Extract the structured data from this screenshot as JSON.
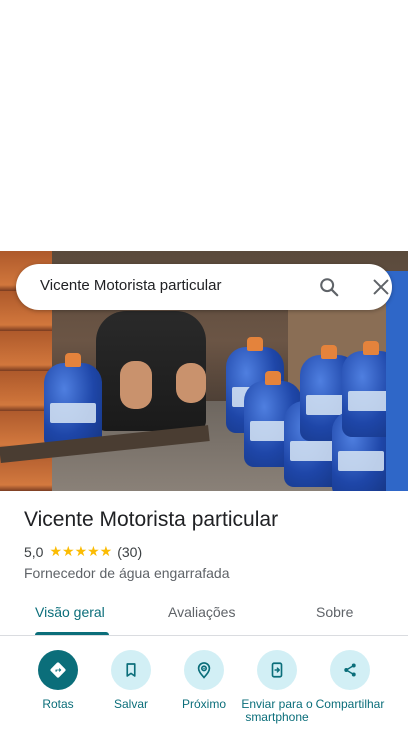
{
  "search": {
    "query": "Vicente Motorista particular"
  },
  "place": {
    "title": "Vicente Motorista particular",
    "rating": "5,0",
    "stars": "★★★★★",
    "review_count": "(30)",
    "category": "Fornecedor de água engarrafada"
  },
  "tabs": [
    {
      "label": "Visão geral",
      "active": true
    },
    {
      "label": "Avaliações",
      "active": false
    },
    {
      "label": "Sobre",
      "active": false
    }
  ],
  "actions": [
    {
      "label": "Rotas",
      "icon": "directions-icon"
    },
    {
      "label": "Salvar",
      "icon": "bookmark-icon"
    },
    {
      "label": "Próximo",
      "icon": "nearby-icon"
    },
    {
      "label": "Enviar para o smartphone",
      "icon": "send-to-phone-icon"
    },
    {
      "label": "Compartilhar",
      "icon": "share-icon"
    }
  ],
  "colors": {
    "accent": "#0b6e7a",
    "action_bg": "#d2eff5",
    "star": "#fbbc04"
  }
}
